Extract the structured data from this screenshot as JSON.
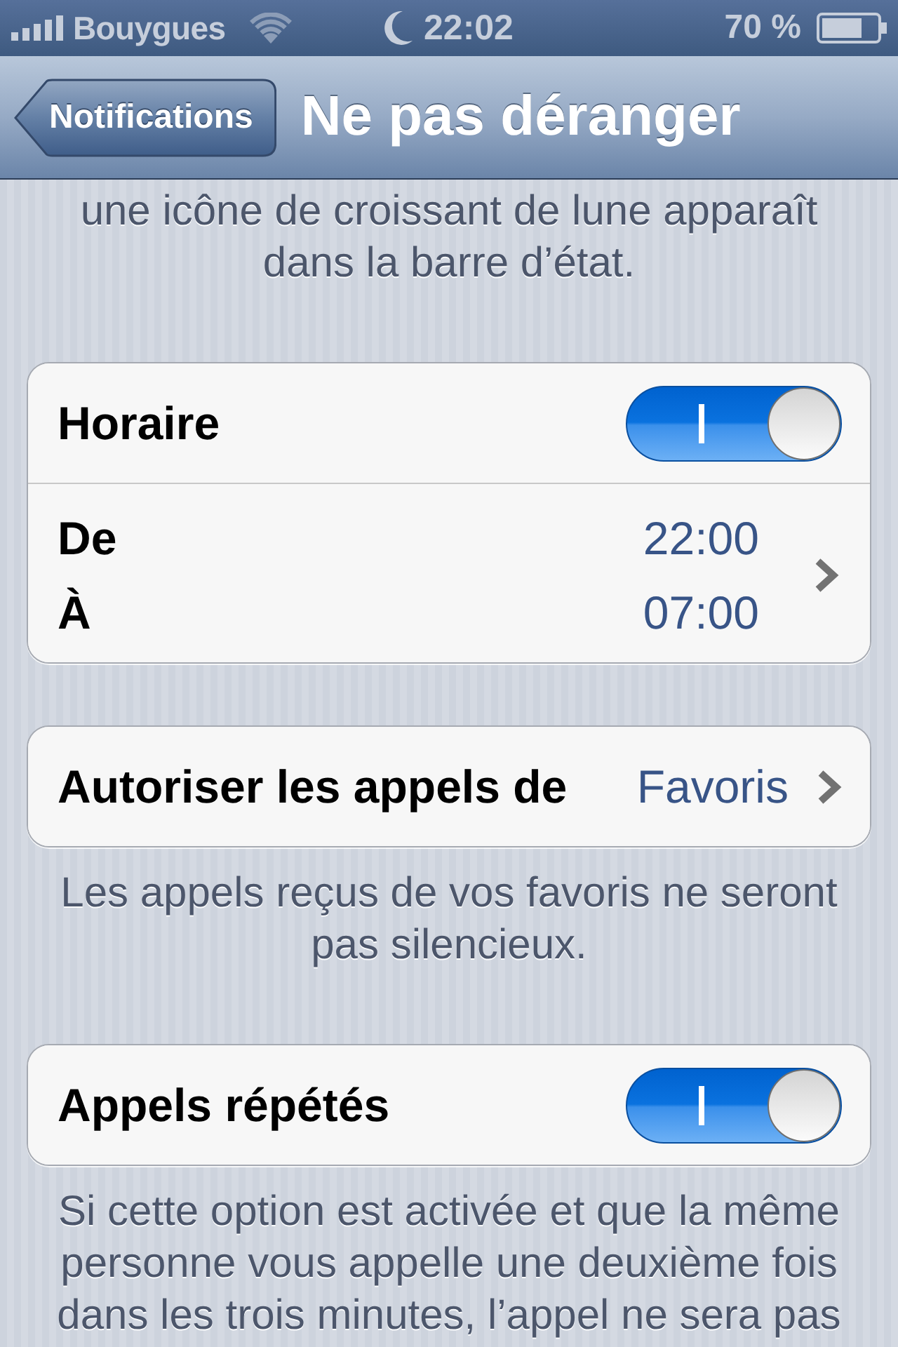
{
  "status_bar": {
    "carrier": "Bouygues",
    "time": "22:02",
    "battery": "70 %"
  },
  "nav_bar": {
    "back_button": "Notifications",
    "title": "Ne pas déranger"
  },
  "top_note": "une icône de croissant de lune apparaît dans la barre d’état.",
  "groups": [
    {
      "rows": [
        {
          "kind": "switch",
          "label": "Horaire",
          "on": true
        },
        {
          "kind": "schedule",
          "entries": [
            {
              "label": "De",
              "value": "22:00"
            },
            {
              "label": "À",
              "value": "07:00"
            }
          ]
        }
      ]
    },
    {
      "rows": [
        {
          "kind": "link",
          "label": "Autoriser les appels de",
          "value": "Favoris"
        }
      ],
      "footer": "Les appels reçus de vos favoris ne seront pas silencieux."
    },
    {
      "rows": [
        {
          "kind": "switch",
          "label": "Appels répétés",
          "on": true
        }
      ],
      "footer": "Si cette option est activée et que la même personne vous appelle une deuxième fois dans les trois minutes, l’appel ne sera pas"
    }
  ]
}
